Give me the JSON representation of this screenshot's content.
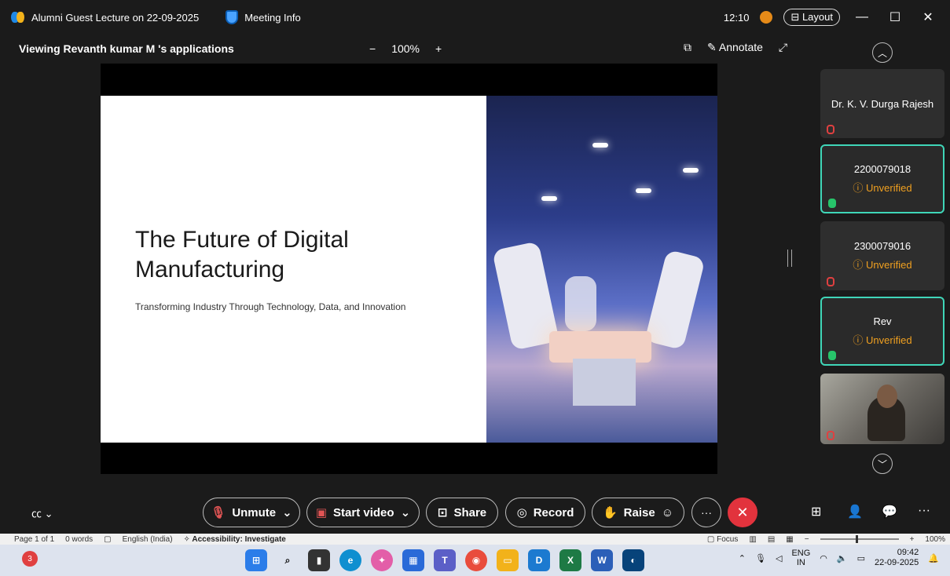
{
  "titlebar": {
    "meeting_title": "Alumni Guest Lecture on 22-09-2025",
    "meeting_info": "Meeting Info",
    "clock": "12:10",
    "layout": "Layout",
    "minimize": "—",
    "maximize": "☐",
    "close": "✕"
  },
  "subbar": {
    "viewing": "Viewing Revanth kumar M 's applications",
    "zoom_out": "−",
    "zoom": "100%",
    "zoom_in": "+",
    "annotate": "Annotate"
  },
  "slide": {
    "title": "The Future of Digital Manufacturing",
    "subtitle": "Transforming Industry Through Technology, Data, and Innovation"
  },
  "participants": [
    {
      "name": "Dr. K. V. Durga Rajesh",
      "status": "",
      "mic": "muted",
      "active": false
    },
    {
      "name": "2200079018",
      "status": "Unverified",
      "mic": "on",
      "active": true
    },
    {
      "name": "2300079016",
      "status": "Unverified",
      "mic": "muted",
      "active": false
    },
    {
      "name": "Rev",
      "status": "Unverified",
      "mic": "on",
      "active": true
    }
  ],
  "controls": {
    "unmute": "Unmute",
    "start_video": "Start video",
    "share": "Share",
    "record": "Record",
    "raise": "Raise",
    "more": "···",
    "end": "✕"
  },
  "wordbar": {
    "page": "Page 1 of 1",
    "words": "0 words",
    "language": "English (India)",
    "accessibility": "Accessibility: Investigate",
    "focus": "Focus",
    "zoom_minus": "−",
    "zoom_plus": "+",
    "zoom": "100%"
  },
  "taskbar": {
    "notification_count": "3",
    "lang_top": "ENG",
    "lang_bottom": "IN",
    "time": "09:42",
    "date": "22-09-2025"
  },
  "colors": {
    "accent_teal": "#3fd6b8",
    "unverified": "#f0a020",
    "end_call": "#e2333d"
  }
}
